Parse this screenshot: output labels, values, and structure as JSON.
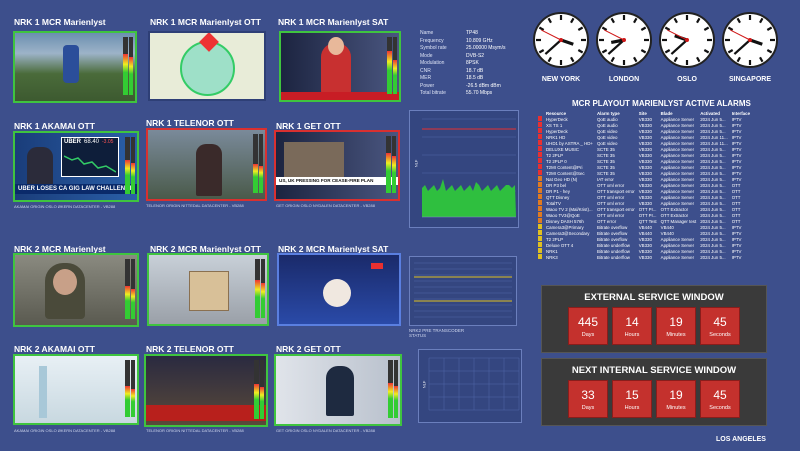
{
  "tiles": [
    {
      "title": "NRK 1 MCR Marienlyst",
      "caption": ""
    },
    {
      "title": "NRK 1 MCR Marienlyst OTT",
      "caption": ""
    },
    {
      "title": "NRK 1 MCR Marienlyst SAT",
      "caption": ""
    },
    {
      "title": "NRK 1 AKAMAI OTT",
      "caption": "AKAMAI ORIGIN OSLO ØKERN DATACENTER - VB288"
    },
    {
      "title": "NRK 1 TELENOR OTT",
      "caption": "TELENOR ORIGIN NITTEDAL DATACENTER - VB288"
    },
    {
      "title": "NRK 1 GET OTT",
      "caption": "GET ORIGIN OSLO NYDALEN DATACENTER - VB288"
    },
    {
      "title": "NRK 2 MCR Marienlyst",
      "caption": ""
    },
    {
      "title": "NRK 2 MCR Marienlyst OTT",
      "caption": ""
    },
    {
      "title": "NRK 2 MCR Marienlyst SAT",
      "caption": ""
    },
    {
      "title": "NRK 2 AKAMAI OTT",
      "caption": "AKAMAI ORIGIN OSLO ØKERN DATACENTER - VB288"
    },
    {
      "title": "NRK 2 TELENOR OTT",
      "caption": "TELENOR ORIGIN NITTEDAL DATACENTER - VB288"
    },
    {
      "title": "NRK 2 GET OTT",
      "caption": "GET ORIGIN OSLO NYDALEN DATACENTER - VB288"
    }
  ],
  "overlays": {
    "ticker_cnbc": "UBER LOSES CA GIG LAW CHALLENGE",
    "stock_name": "UBER",
    "stock_price": "68.40",
    "stock_change": "-3.05",
    "ticker_sky": "US, UK PRESSING FOR CEASE-FIRE PLAN"
  },
  "satellite": {
    "rows": [
      {
        "k": "Name",
        "v": "TP48"
      },
      {
        "k": "Frequency",
        "v": "10.809 GHz"
      },
      {
        "k": "Symbol rate",
        "v": "25.00000 Msym/s"
      },
      {
        "k": "Mode",
        "v": "DVB-S2"
      },
      {
        "k": "Modulation",
        "v": "8PSK"
      },
      {
        "k": "CNR",
        "v": "18.7 dB"
      },
      {
        "k": "MER",
        "v": "18.5 dB"
      },
      {
        "k": "Power",
        "v": "-26.5 dBm dBm"
      },
      {
        "k": "Total bitrate",
        "v": "55.70 Mbps"
      }
    ]
  },
  "graph1": {
    "ylabel": "NLF"
  },
  "graph2": {
    "caption": "NRK2 PRE TRANSCODER STATUS"
  },
  "graph3": {
    "ylabel": "NLF"
  },
  "clocks": [
    {
      "label": "NEW YORK",
      "h": 3,
      "m": 38
    },
    {
      "label": "LONDON",
      "h": 8,
      "m": 38
    },
    {
      "label": "OSLO",
      "h": 9,
      "m": 38
    },
    {
      "label": "SINGAPORE",
      "h": 3,
      "m": 38
    }
  ],
  "alarms": {
    "title": "MCR PLAYOUT MARIENLYST ACTIVE ALARMS",
    "headers": [
      "",
      "Resource",
      "Alarm type",
      "Site",
      "Blade",
      "Activated",
      "Interface"
    ],
    "rows": [
      {
        "color": "#e83030",
        "resource": "HyperDeck",
        "type": "QoE audio",
        "site": "VB330",
        "blade": "Appliance Server",
        "activated": "2024 Jun 5...",
        "iface": "IPTV"
      },
      {
        "color": "#e83030",
        "resource": "XS TS 1",
        "type": "QoE audio",
        "site": "VB330",
        "blade": "Appliance Server",
        "activated": "2024 Jun 5...",
        "iface": "IPTV"
      },
      {
        "color": "#e83030",
        "resource": "HyperDeck",
        "type": "QoE video",
        "site": "VB330",
        "blade": "Appliance Server",
        "activated": "2024 Jun 5...",
        "iface": "IPTV"
      },
      {
        "color": "#e83030",
        "resource": "NRK1 HD",
        "type": "QoE video",
        "site": "VB330",
        "blade": "Appliance Server",
        "activated": "2024 Jun 11...",
        "iface": "IPTV"
      },
      {
        "color": "#e83030",
        "resource": "UHD1 by ASTRA _ HD+",
        "type": "QoE video",
        "site": "VB330",
        "blade": "Appliance Server",
        "activated": "2024 Jun 11...",
        "iface": "IPTV"
      },
      {
        "color": "#e83030",
        "resource": "DELUXE MUSIC",
        "type": "SCTE 35",
        "site": "VB330",
        "blade": "Appliance Server",
        "activated": "2024 Jun 5...",
        "iface": "IPTV"
      },
      {
        "color": "#e83030",
        "resource": "T2 2PLP",
        "type": "SCTE 35",
        "site": "VB330",
        "blade": "Appliance Server",
        "activated": "2024 Jun 5...",
        "iface": "IPTV"
      },
      {
        "color": "#e83030",
        "resource": "T2 2PLP 0",
        "type": "SCTE 35",
        "site": "VB330",
        "blade": "Appliance Server",
        "activated": "2024 Jun 5...",
        "iface": "IPTV"
      },
      {
        "color": "#e83030",
        "resource": "T2MI Content@Pri",
        "type": "SCTE 35",
        "site": "VB330",
        "blade": "Appliance Server",
        "activated": "2024 Jun 5...",
        "iface": "IPTV"
      },
      {
        "color": "#e83030",
        "resource": "T2MI Content@Sec",
        "type": "SCTE 35",
        "site": "VB330",
        "blade": "Appliance Server",
        "activated": "2024 Jun 5...",
        "iface": "IPTV"
      },
      {
        "color": "#e07a20",
        "resource": "Nat Geo HD (N)",
        "type": "IAT error",
        "site": "VB330",
        "blade": "Appliance Server",
        "activated": "2024 Jun 5...",
        "iface": "IPTV"
      },
      {
        "color": "#e07a20",
        "resource": "DR P3 bel",
        "type": "OTT xml error",
        "site": "VB330",
        "blade": "Appliance Server",
        "activated": "2024 Jun 5...",
        "iface": "OTT"
      },
      {
        "color": "#e07a20",
        "resource": "DR P1 - hey",
        "type": "OTT transport error",
        "site": "VB330",
        "blade": "Appliance Server",
        "activated": "2024 Jun 5...",
        "iface": "OTT"
      },
      {
        "color": "#e07a20",
        "resource": "QTT Disney",
        "type": "OTT xml error",
        "site": "VB330",
        "blade": "Appliance Server",
        "activated": "2024 Jun 5...",
        "iface": "OTT"
      },
      {
        "color": "#e07a20",
        "resource": "TotalTV",
        "type": "OTT xml error",
        "site": "VB330",
        "blade": "Appliance Server",
        "activated": "2024 Jun 5...",
        "iface": "OTT"
      },
      {
        "color": "#e07a20",
        "resource": "Waoo TV 2 (Mal/Krist)...",
        "type": "OTT transport error",
        "site": "OTT Pr...",
        "blade": "OTT Extractor",
        "activated": "2024 Jun 5...",
        "iface": "OTT"
      },
      {
        "color": "#e07a20",
        "resource": "Waoo TV3@QoE",
        "type": "OTT xml error",
        "site": "OTT Pr...",
        "blade": "OTT Extractor",
        "activated": "2024 Jun 5...",
        "iface": "OTT"
      },
      {
        "color": "#e07a20",
        "resource": "Disney DASH 576h",
        "type": "OTT error",
        "site": "QTT Test",
        "blade": "QTT Manager test",
        "activated": "2024 Jun 5...",
        "iface": "OTT"
      },
      {
        "color": "#e0c020",
        "resource": "Camera3@Primary",
        "type": "Bitrate overflow",
        "site": "VB440",
        "blade": "VB440",
        "activated": "2024 Jun 5...",
        "iface": "IPTV"
      },
      {
        "color": "#e0c020",
        "resource": "Camera3@Secondary",
        "type": "Bitrate overflow",
        "site": "VB440",
        "blade": "VB440",
        "activated": "2024 Jun 5...",
        "iface": "IPTV"
      },
      {
        "color": "#e0c020",
        "resource": "T2 2PLP",
        "type": "Bitrate overflow",
        "site": "VB330",
        "blade": "Appliance Server",
        "activated": "2024 Jun 5...",
        "iface": "IPTV"
      },
      {
        "color": "#e0c020",
        "resource": "Deluxe OTT 4",
        "type": "Bitrate underflow",
        "site": "VB330",
        "blade": "Appliance Server",
        "activated": "2024 Jun 5...",
        "iface": "IPTV"
      },
      {
        "color": "#e0c020",
        "resource": "NRK1",
        "type": "Bitrate underflow",
        "site": "VB330",
        "blade": "Appliance Server",
        "activated": "2024 Jun 5...",
        "iface": "IPTV"
      },
      {
        "color": "#e0c020",
        "resource": "NRK3",
        "type": "Bitrate underflow",
        "site": "VB330",
        "blade": "Appliance Server",
        "activated": "2024 Jun 5...",
        "iface": "IPTV"
      }
    ]
  },
  "external_window": {
    "title": "EXTERNAL SERVICE WINDOW",
    "units": [
      {
        "value": "445",
        "label": "Days"
      },
      {
        "value": "14",
        "label": "Hours"
      },
      {
        "value": "19",
        "label": "Minutes"
      },
      {
        "value": "45",
        "label": "Seconds"
      }
    ]
  },
  "internal_window": {
    "title": "NEXT INTERNAL SERVICE WINDOW",
    "units": [
      {
        "value": "33",
        "label": "Days"
      },
      {
        "value": "15",
        "label": "Hours"
      },
      {
        "value": "19",
        "label": "Minutes"
      },
      {
        "value": "45",
        "label": "Seconds"
      }
    ]
  },
  "bottom_label": "LOS ANGELES",
  "colors": {
    "background": "#3d4f8c",
    "ok_border": "#3fc43f",
    "alarm_border": "#d93030",
    "countdown": "#c4312d"
  }
}
